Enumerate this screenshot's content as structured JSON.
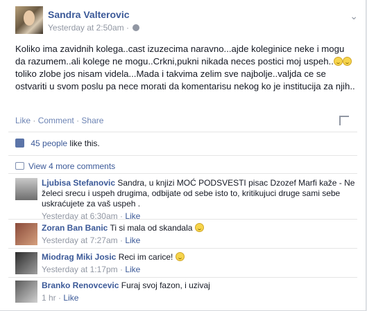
{
  "post": {
    "author": "Sandra Valterovic",
    "timestamp": "Yesterday at 2:50am",
    "text_part1": "Koliko ima zavidnih kolega..cast izuzecima naravno...ajde koleginice neke i mogu da razumem..ali kolege ne mogu..Crkni,pukni nikada neces postici moj uspeh..",
    "text_part2": "toliko zlobe jos nisam videla...Mada i takvima zelim sve najbolje..valjda ce se ostvariti u svom poslu pa nece morati da komentarisu nekog ko je institucija za njih..",
    "actions": {
      "like": "Like",
      "comment": "Comment",
      "share": "Share",
      "separator": "·"
    }
  },
  "likes": {
    "count_text": "45 people",
    "suffix": "like this."
  },
  "view_more": "View 4 more comments",
  "comments": [
    {
      "name": "Ljubisa Stefanovic",
      "text": "Sandra, u knjizi MOĆ PODSVESTI pisac Dzozef Marfi kaže - Ne želeci srecu i uspeh drugima, odbijate od sebe isto to, kritikujuci druge sami sebe uskraćujete za vaš uspeh .",
      "time": "Yesterday at 6:30am",
      "like": "Like"
    },
    {
      "name": "Zoran Ban Banic",
      "text": "Ti si mala od skandala",
      "time": "Yesterday at 7:27am",
      "like": "Like"
    },
    {
      "name": "Miodrag Miki Josic",
      "text": "Reci im carice!",
      "time": "Yesterday at 1:17pm",
      "like": "Like"
    },
    {
      "name": "Branko Renovcevic",
      "text": "Furaj svoj fazon, i uzivaj",
      "time": "1 hr",
      "like": "Like"
    }
  ]
}
